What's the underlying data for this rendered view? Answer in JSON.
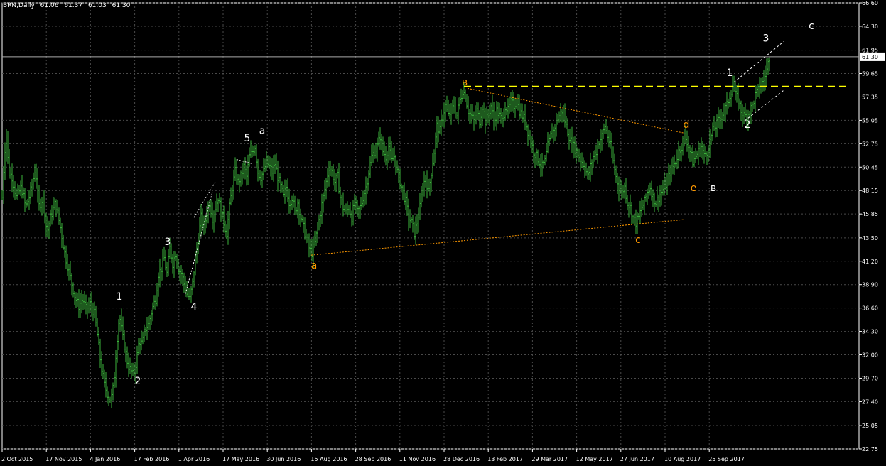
{
  "header": {
    "symbol": "BRN,Daily",
    "open": "61.06",
    "high": "61.37",
    "low": "61.03",
    "close": "61.30"
  },
  "price_tag": "61.30",
  "colors": {
    "background": "#000000",
    "axis": "#ffffff",
    "grid": "#4a4a4a",
    "bars": "#3cb43c",
    "wave_white": "#ffffff",
    "wave_orange": "#ff9900",
    "level_line": "#ffff00"
  },
  "chart_data": {
    "type": "bar",
    "title": "",
    "xlabel": "",
    "ylabel": "",
    "ylim": [
      22.75,
      66.6
    ],
    "y_ticks": [
      "66.60",
      "64.30",
      "61.95",
      "59.65",
      "57.35",
      "55.05",
      "52.75",
      "50.45",
      "48.15",
      "45.85",
      "43.50",
      "41.20",
      "38.90",
      "36.60",
      "34.30",
      "32.00",
      "29.70",
      "27.40",
      "25.05",
      "22.75"
    ],
    "x_tick_labels": [
      "2 Oct 2015",
      "17 Nov 2015",
      "4 Jan 2016",
      "17 Feb 2016",
      "1 Apr 2016",
      "17 May 2016",
      "30 Jun 2016",
      "15 Aug 2016",
      "28 Sep 2016",
      "11 Nov 2016",
      "28 Dec 2016",
      "13 Feb 2017",
      "29 Mar 2017",
      "12 May 2017",
      "27 Jun 2017",
      "10 Aug 2017",
      "25 Sep 2017"
    ],
    "price_path": [
      [
        0,
        47.5
      ],
      [
        3,
        51.5
      ],
      [
        6,
        53.8
      ],
      [
        9,
        50.0
      ],
      [
        14,
        49.5
      ],
      [
        20,
        47.5
      ],
      [
        27,
        48.5
      ],
      [
        33,
        46.5
      ],
      [
        38,
        47.5
      ],
      [
        43,
        49.0
      ],
      [
        47,
        50.5
      ],
      [
        51,
        46.5
      ],
      [
        58,
        47.5
      ],
      [
        63,
        44.0
      ],
      [
        68,
        45.5
      ],
      [
        75,
        47.0
      ],
      [
        82,
        44.5
      ],
      [
        88,
        42.0
      ],
      [
        93,
        40.5
      ],
      [
        98,
        39.0
      ],
      [
        103,
        37.5
      ],
      [
        108,
        36.8
      ],
      [
        113,
        37.5
      ],
      [
        118,
        36.5
      ],
      [
        124,
        37.0
      ],
      [
        130,
        36.0
      ],
      [
        134,
        34.0
      ],
      [
        139,
        31.0
      ],
      [
        144,
        29.0
      ],
      [
        149,
        28.0
      ],
      [
        153,
        27.5
      ],
      [
        157,
        29.0
      ],
      [
        161,
        33.0
      ],
      [
        165,
        36.0
      ],
      [
        169,
        34.0
      ],
      [
        173,
        32.5
      ],
      [
        177,
        31.0
      ],
      [
        181,
        30.5
      ],
      [
        185,
        29.9
      ],
      [
        189,
        31.5
      ],
      [
        193,
        33.5
      ],
      [
        197,
        33.0
      ],
      [
        201,
        34.5
      ],
      [
        206,
        35.0
      ],
      [
        211,
        36.5
      ],
      [
        216,
        37.5
      ],
      [
        220,
        40.0
      ],
      [
        224,
        40.5
      ],
      [
        228,
        41.5
      ],
      [
        232,
        40.0
      ],
      [
        236,
        42.5
      ],
      [
        240,
        41.0
      ],
      [
        244,
        42.0
      ],
      [
        248,
        40.5
      ],
      [
        252,
        40.0
      ],
      [
        256,
        39.0
      ],
      [
        260,
        38.0
      ],
      [
        264,
        37.5
      ],
      [
        268,
        39.0
      ],
      [
        272,
        41.5
      ],
      [
        276,
        43.5
      ],
      [
        280,
        45.5
      ],
      [
        284,
        44.5
      ],
      [
        288,
        46.0
      ],
      [
        292,
        47.0
      ],
      [
        296,
        45.5
      ],
      [
        300,
        46.5
      ],
      [
        304,
        47.5
      ],
      [
        308,
        46.0
      ],
      [
        312,
        45.0
      ],
      [
        316,
        44.0
      ],
      [
        320,
        46.5
      ],
      [
        324,
        48.5
      ],
      [
        328,
        50.0
      ],
      [
        332,
        49.0
      ],
      [
        336,
        49.5
      ],
      [
        340,
        50.5
      ],
      [
        344,
        49.5
      ],
      [
        348,
        51.5
      ],
      [
        352,
        52.0
      ],
      [
        356,
        52.5
      ],
      [
        360,
        50.0
      ],
      [
        364,
        49.5
      ],
      [
        368,
        50.0
      ],
      [
        372,
        51.0
      ],
      [
        376,
        50.5
      ],
      [
        380,
        50.0
      ],
      [
        384,
        50.8
      ],
      [
        388,
        49.5
      ],
      [
        392,
        48.5
      ],
      [
        396,
        47.5
      ],
      [
        400,
        48.5
      ],
      [
        404,
        47.0
      ],
      [
        408,
        47.5
      ],
      [
        412,
        46.0
      ],
      [
        416,
        47.0
      ],
      [
        420,
        45.5
      ],
      [
        424,
        44.5
      ],
      [
        428,
        43.5
      ],
      [
        432,
        42.5
      ],
      [
        436,
        42.0
      ],
      [
        440,
        43.0
      ],
      [
        444,
        44.5
      ],
      [
        448,
        46.0
      ],
      [
        452,
        47.5
      ],
      [
        456,
        49.0
      ],
      [
        460,
        50.5
      ],
      [
        464,
        50.0
      ],
      [
        468,
        49.0
      ],
      [
        472,
        49.5
      ],
      [
        476,
        47.5
      ],
      [
        480,
        46.5
      ],
      [
        484,
        46.0
      ],
      [
        488,
        46.5
      ],
      [
        492,
        45.5
      ],
      [
        496,
        47.0
      ],
      [
        500,
        46.0
      ],
      [
        504,
        46.5
      ],
      [
        508,
        47.5
      ],
      [
        512,
        48.5
      ],
      [
        516,
        50.0
      ],
      [
        520,
        51.5
      ],
      [
        524,
        52.0
      ],
      [
        528,
        52.5
      ],
      [
        532,
        53.5
      ],
      [
        536,
        52.0
      ],
      [
        540,
        51.5
      ],
      [
        544,
        52.5
      ],
      [
        548,
        51.0
      ],
      [
        552,
        51.5
      ],
      [
        556,
        50.0
      ],
      [
        560,
        49.0
      ],
      [
        564,
        48.0
      ],
      [
        568,
        47.0
      ],
      [
        572,
        45.5
      ],
      [
        576,
        45.0
      ],
      [
        580,
        44.0
      ],
      [
        584,
        45.0
      ],
      [
        588,
        46.5
      ],
      [
        592,
        48.5
      ],
      [
        596,
        49.5
      ],
      [
        600,
        48.0
      ],
      [
        604,
        50.0
      ],
      [
        608,
        52.0
      ],
      [
        612,
        54.5
      ],
      [
        616,
        54.0
      ],
      [
        620,
        55.5
      ],
      [
        624,
        56.5
      ],
      [
        628,
        55.5
      ],
      [
        632,
        56.0
      ],
      [
        636,
        56.5
      ],
      [
        640,
        55.5
      ],
      [
        644,
        57.0
      ],
      [
        648,
        58.0
      ],
      [
        652,
        57.5
      ],
      [
        656,
        56.0
      ],
      [
        660,
        55.5
      ],
      [
        664,
        55.0
      ],
      [
        668,
        56.0
      ],
      [
        672,
        55.0
      ],
      [
        676,
        56.5
      ],
      [
        680,
        55.0
      ],
      [
        684,
        55.5
      ],
      [
        688,
        56.5
      ],
      [
        692,
        55.0
      ],
      [
        696,
        56.0
      ],
      [
        700,
        55.5
      ],
      [
        704,
        55.0
      ],
      [
        708,
        56.5
      ],
      [
        712,
        56.0
      ],
      [
        716,
        56.8
      ],
      [
        720,
        56.5
      ],
      [
        724,
        57.0
      ],
      [
        728,
        56.0
      ],
      [
        732,
        55.5
      ],
      [
        736,
        55.0
      ],
      [
        740,
        54.0
      ],
      [
        744,
        53.0
      ],
      [
        748,
        52.0
      ],
      [
        752,
        51.5
      ],
      [
        756,
        51.0
      ],
      [
        760,
        50.5
      ],
      [
        764,
        51.0
      ],
      [
        768,
        52.5
      ],
      [
        772,
        53.5
      ],
      [
        776,
        54.0
      ],
      [
        780,
        55.0
      ],
      [
        784,
        55.5
      ],
      [
        788,
        56.0
      ],
      [
        792,
        55.0
      ],
      [
        796,
        54.0
      ],
      [
        800,
        53.0
      ],
      [
        804,
        52.5
      ],
      [
        808,
        52.0
      ],
      [
        812,
        51.5
      ],
      [
        816,
        51.0
      ],
      [
        820,
        50.5
      ],
      [
        824,
        49.5
      ],
      [
        828,
        50.5
      ],
      [
        832,
        51.5
      ],
      [
        836,
        52.0
      ],
      [
        840,
        53.0
      ],
      [
        844,
        53.5
      ],
      [
        848,
        54.5
      ],
      [
        852,
        53.5
      ],
      [
        856,
        52.5
      ],
      [
        860,
        51.0
      ],
      [
        864,
        49.5
      ],
      [
        868,
        48.5
      ],
      [
        872,
        48.0
      ],
      [
        876,
        48.5
      ],
      [
        880,
        47.0
      ],
      [
        884,
        46.5
      ],
      [
        888,
        45.5
      ],
      [
        892,
        45.0
      ],
      [
        896,
        45.5
      ],
      [
        900,
        46.5
      ],
      [
        904,
        47.0
      ],
      [
        908,
        48.0
      ],
      [
        912,
        48.5
      ],
      [
        916,
        47.5
      ],
      [
        920,
        47.0
      ],
      [
        924,
        47.5
      ],
      [
        928,
        48.0
      ],
      [
        932,
        48.5
      ],
      [
        936,
        49.0
      ],
      [
        940,
        50.0
      ],
      [
        944,
        50.5
      ],
      [
        948,
        51.0
      ],
      [
        952,
        52.0
      ],
      [
        956,
        52.5
      ],
      [
        960,
        53.5
      ],
      [
        964,
        53.0
      ],
      [
        968,
        52.0
      ],
      [
        972,
        51.0
      ],
      [
        976,
        51.5
      ],
      [
        980,
        52.0
      ],
      [
        984,
        52.5
      ],
      [
        988,
        51.5
      ],
      [
        992,
        52.0
      ],
      [
        996,
        53.0
      ],
      [
        1000,
        54.0
      ],
      [
        1004,
        54.5
      ],
      [
        1008,
        55.0
      ],
      [
        1012,
        55.5
      ],
      [
        1016,
        56.0
      ],
      [
        1020,
        56.5
      ],
      [
        1024,
        57.5
      ],
      [
        1028,
        58.5
      ],
      [
        1032,
        57.5
      ],
      [
        1036,
        57.0
      ],
      [
        1040,
        56.0
      ],
      [
        1044,
        55.5
      ],
      [
        1048,
        55.5
      ],
      [
        1052,
        56.0
      ],
      [
        1056,
        56.5
      ],
      [
        1060,
        57.5
      ],
      [
        1064,
        58.0
      ],
      [
        1068,
        58.5
      ],
      [
        1072,
        59.0
      ],
      [
        1076,
        60.0
      ],
      [
        1080,
        61.3
      ]
    ],
    "wave_labels": [
      {
        "text": "1",
        "price": 37.4,
        "bar": 165,
        "color": "#ffffff"
      },
      {
        "text": "2",
        "price": 29.1,
        "bar": 191,
        "color": "#ffffff"
      },
      {
        "text": "3",
        "price": 42.8,
        "bar": 233,
        "color": "#ffffff"
      },
      {
        "text": "4",
        "price": 36.4,
        "bar": 270,
        "color": "#ffffff"
      },
      {
        "text": "5",
        "price": 53.0,
        "bar": 345,
        "color": "#ffffff"
      },
      {
        "text": "a",
        "price": 53.7,
        "bar": 366,
        "color": "#ffffff"
      },
      {
        "text": "a",
        "price": 40.5,
        "bar": 439,
        "color": "#ff9900"
      },
      {
        "text": "в",
        "price": 58.5,
        "bar": 651,
        "color": "#ff9900"
      },
      {
        "text": "c",
        "price": 43.0,
        "bar": 895,
        "color": "#ff9900"
      },
      {
        "text": "d",
        "price": 54.3,
        "bar": 963,
        "color": "#ff9900"
      },
      {
        "text": "e",
        "price": 48.1,
        "bar": 973,
        "color": "#ff9900"
      },
      {
        "text": "в",
        "price": 48.1,
        "bar": 1001,
        "color": "#ffffff"
      },
      {
        "text": "1",
        "price": 59.4,
        "bar": 1024,
        "color": "#ffffff"
      },
      {
        "text": "2",
        "price": 54.3,
        "bar": 1049,
        "color": "#ffffff"
      },
      {
        "text": "3",
        "price": 62.8,
        "bar": 1075,
        "color": "#ffffff"
      },
      {
        "text": "c",
        "price": 64.0,
        "bar": 1139,
        "color": "#ffffff"
      }
    ]
  }
}
